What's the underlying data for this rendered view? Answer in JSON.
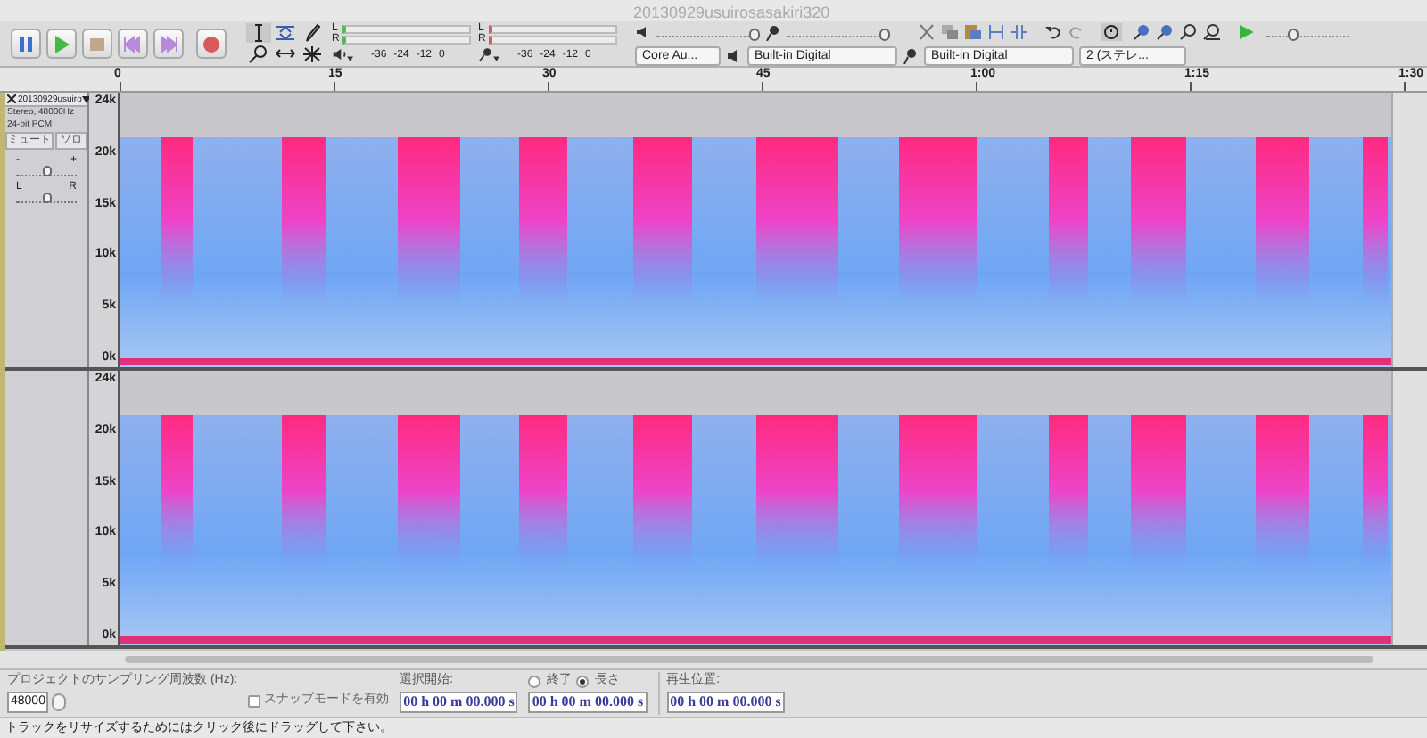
{
  "window": {
    "title": "20130929usuirosasakiri320"
  },
  "transport": [
    {
      "kind": "pause"
    },
    {
      "kind": "play"
    },
    {
      "kind": "stop"
    },
    {
      "kind": "skip-start"
    },
    {
      "kind": "skip-end"
    },
    {
      "kind": "record"
    }
  ],
  "meters": {
    "playback_ticks": [
      "-36",
      "-24",
      "-12",
      "0"
    ],
    "record_ticks": [
      "-36",
      "-24",
      "-12",
      "0"
    ],
    "playback_channels": [
      "L",
      "R"
    ],
    "record_channels": [
      "L",
      "R"
    ]
  },
  "mixer": {
    "playback": {
      "level": 1
    },
    "recording": {
      "level": 1
    },
    "play_speed": {
      "level": 0.3
    }
  },
  "devices": [
    {
      "kind": "host",
      "value": "Core Au..."
    },
    {
      "kind": "output",
      "value": "Built-in Digital"
    },
    {
      "kind": "input",
      "value": "Built-in Digital"
    },
    {
      "kind": "channels",
      "value": "2 (ステレ..."
    }
  ],
  "timeline": {
    "labels": [
      "0",
      "15",
      "30",
      "45",
      "1:00",
      "1:15",
      "1:30"
    ]
  },
  "tracks": [
    {
      "name": "20130929usuiro",
      "info": [
        "Stereo, 48000Hz",
        "24-bit PCM"
      ],
      "buttons": [
        "ミュート",
        "ソロ"
      ],
      "gain": {
        "minus": "-",
        "plus": "+",
        "level": 0.5
      },
      "pan": {
        "left": "L",
        "right": "R",
        "level": 0.5
      },
      "axis": [
        "24k",
        "20k",
        "15k",
        "10k",
        "5k",
        "0k"
      ]
    },
    {
      "axis": [
        "24k",
        "20k",
        "15k",
        "10k",
        "5k",
        "0k"
      ]
    }
  ],
  "selection_bar": {
    "rate_label": "プロジェクトのサンプリング周波数 (Hz):",
    "rate": "48000",
    "snap": {
      "label": "スナップモードを有効",
      "checked": false
    },
    "start_label": "選択開始:",
    "end_radio": {
      "label": "終了",
      "selected": false
    },
    "length_radio": {
      "label": "長さ",
      "selected": true
    },
    "position_label": "再生位置:",
    "times": [
      "00 h 00 m 00.000 s",
      "00 h 00 m 00.000 s",
      "00 h 00 m 00.000 s"
    ]
  },
  "status_bar": "トラックをリサイズするためにはクリック後にドラッグして下さい。"
}
